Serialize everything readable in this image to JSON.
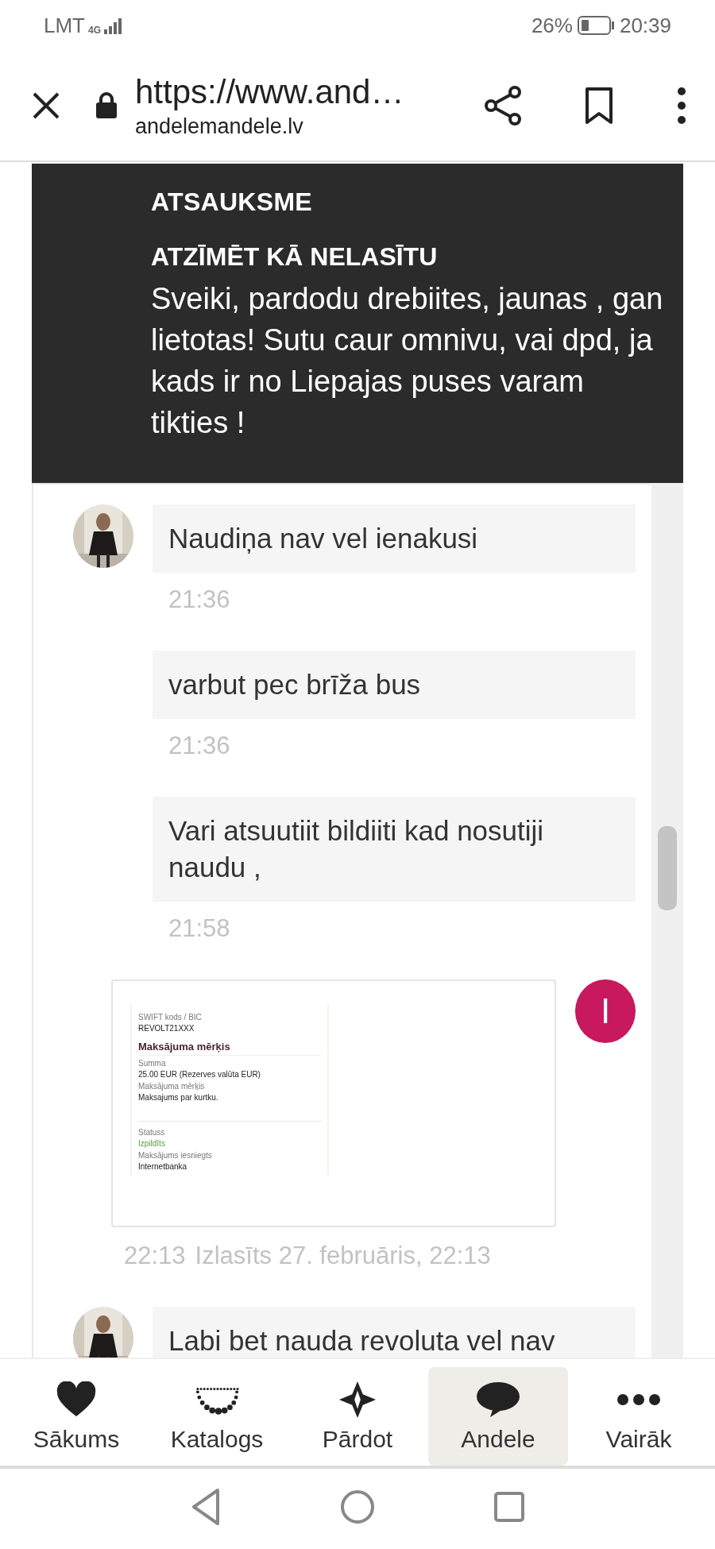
{
  "status_bar": {
    "carrier": "LMT",
    "network": "4G",
    "battery": "26%",
    "time": "20:39"
  },
  "browser": {
    "url": "https://www.and…",
    "domain": "andelemandele.lv"
  },
  "notice": {
    "title": "ATSAUKSME",
    "action": "ATZĪMĒT KĀ NELASĪTU",
    "text": "Sveiki, pardodu drebiites, jaunas , gan lietotas! Sutu caur omnivu, vai dpd, ja kads ir no Liepajas puses varam tikties !"
  },
  "messages": [
    {
      "kind": "text",
      "avatar": true,
      "text": "Naudiņa nav vel ienakusi",
      "time": "21:36"
    },
    {
      "kind": "text",
      "avatar": false,
      "text": "varbut pec brīža bus",
      "time": "21:36"
    },
    {
      "kind": "text",
      "avatar": false,
      "text": "Vari atsuutiit bildiiti kad nosutiji naudu ,",
      "time": "21:58"
    },
    {
      "avatar_letter": "I",
      "color": "#c8185e",
      "time": "22:13",
      "read_receipt": "Izlasīts 27. februāris, 22:13",
      "lines": [
        {
          "kind": "label",
          "text": "SWIFT kods / BIC"
        },
        {
          "kind": "value",
          "text": "REVOLT21XXX"
        },
        {
          "kind": "heading",
          "text": "Maksājuma mērķis"
        },
        {
          "kind": "label",
          "text": "Summa"
        },
        {
          "kind": "value",
          "text": "25.00 EUR (Rezerves valūta EUR)"
        },
        {
          "kind": "label",
          "text": "Maksājuma mērķis"
        },
        {
          "kind": "value",
          "text": "Maksajums par kurtku."
        },
        {
          "kind": "divider"
        },
        {
          "kind": "label",
          "text": "Statuss"
        },
        {
          "kind": "status",
          "text": "Izpildīts"
        },
        {
          "kind": "label",
          "text": "Maksājums iesniegts"
        },
        {
          "kind": "value",
          "text": "Internetbanka"
        }
      ]
    },
    {
      "kind": "text",
      "avatar": true,
      "text": "Labi bet nauda revoluta vel nav"
    }
  ],
  "bottom_nav": [
    {
      "label": "Sākums",
      "selected": false
    },
    {
      "label": "Katalogs",
      "selected": false
    },
    {
      "label": "Pārdot",
      "selected": false
    },
    {
      "label": "Andele",
      "selected": true
    },
    {
      "label": "Vairāk",
      "selected": false
    }
  ]
}
